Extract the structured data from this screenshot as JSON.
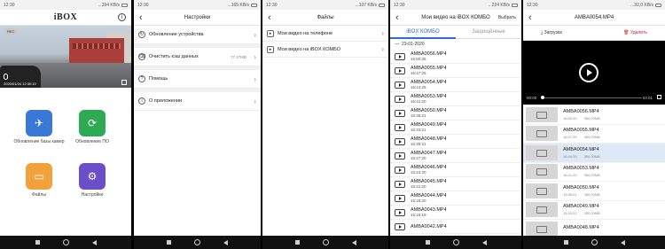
{
  "status": {
    "time": "12:30",
    "net1": "...394 KB/s",
    "net2": "...165 KB/s",
    "net3": "...107 KB/s",
    "net4": "...224 KB/s",
    "net5": "...32,0 KB/s",
    "battery": "46"
  },
  "home": {
    "logo": "iBOX",
    "rec": "REC",
    "timestamp": "2020/01/24 12:30:10",
    "tiles": [
      {
        "label": "Обновление базы камер",
        "icon": "satellite-icon",
        "color": "#3a78d8"
      },
      {
        "label": "Обновление ПО",
        "icon": "refresh-icon",
        "color": "#2faa54"
      },
      {
        "label": "Файлы",
        "icon": "folder-icon",
        "color": "#f2a23a"
      },
      {
        "label": "Настройки",
        "icon": "gear-icon",
        "color": "#6a4fc8"
      }
    ]
  },
  "settings": {
    "title": "Настройки",
    "items": [
      {
        "label": "Обновление устройства",
        "value": ""
      },
      {
        "label": "Очистить кэш данных",
        "value": "77,47MB"
      },
      {
        "label": "Помощь",
        "value": ""
      },
      {
        "label": "О приложении",
        "value": ""
      }
    ]
  },
  "files": {
    "title": "Файлы",
    "items": [
      "Мои видео на телефоне",
      "Мои видео на iBOX КОМБО"
    ]
  },
  "videos": {
    "title": "Мои видео на iBOX КОМБО",
    "select": "Выбрать",
    "tabs": [
      "iBOX КОМБО",
      "Защищённые"
    ],
    "date": "23-01-2020",
    "list": [
      {
        "name": "AMBA0056.MP4",
        "time": "16:50:25"
      },
      {
        "name": "AMBA0055.MP4",
        "time": "16:47:25"
      },
      {
        "name": "AMBA0054.MP4",
        "time": "16:44:25"
      },
      {
        "name": "AMBA0053.MP4",
        "time": "16:41:20"
      },
      {
        "name": "AMBA0050.MP4",
        "time": "15:36:21"
      },
      {
        "name": "AMBA0049.MP4",
        "time": "15:33:21"
      },
      {
        "name": "AMBA0048.MP4",
        "time": "15:30:21"
      },
      {
        "name": "AMBA0047.MP4",
        "time": "15:27:20"
      },
      {
        "name": "AMBA0046.MP4",
        "time": "15:24:20"
      },
      {
        "name": "AMBA0045.MP4",
        "time": "15:21:20"
      },
      {
        "name": "AMBA0044.MP4",
        "time": "15:18:20"
      },
      {
        "name": "AMBA0043.MP4",
        "time": "15:15:19"
      },
      {
        "name": "AMBA0042.MP4",
        "time": ""
      }
    ]
  },
  "player": {
    "title": "AMBA0054.MP4",
    "download": "Загрузка",
    "delete": "Удалить",
    "time_start": "00:00",
    "time_end": "03:01",
    "list": [
      {
        "name": "AMBA0056.MP4",
        "time": "16:50:25",
        "size": "390,00MB",
        "highlight": false
      },
      {
        "name": "AMBA0055.MP4",
        "time": "16:47:25",
        "size": "390,00MB",
        "highlight": false
      },
      {
        "name": "AMBA0054.MP4",
        "time": "16:44:25",
        "size": "390,00MB",
        "highlight": true
      },
      {
        "name": "AMBA0053.MP4",
        "time": "16:41:20",
        "size": "390,00MB",
        "highlight": false
      },
      {
        "name": "AMBA0050.MP4",
        "time": "15:36:21",
        "size": "390,00MB",
        "highlight": false
      },
      {
        "name": "AMBA0049.MP4",
        "time": "15:33:21",
        "size": "390,00MB",
        "highlight": false
      },
      {
        "name": "AMBA0048.MP4",
        "time": "",
        "size": "",
        "highlight": false
      }
    ]
  }
}
